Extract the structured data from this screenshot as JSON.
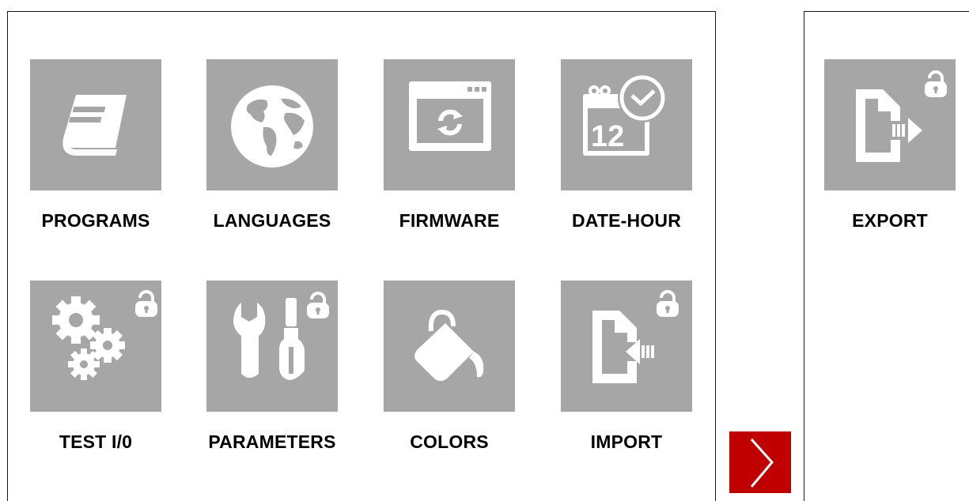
{
  "menu": {
    "items": [
      {
        "label": "PROGRAMS",
        "icon": "book-icon",
        "locked": false
      },
      {
        "label": "LANGUAGES",
        "icon": "globe-icon",
        "locked": false
      },
      {
        "label": "FIRMWARE",
        "icon": "firmware-refresh-icon",
        "locked": false
      },
      {
        "label": "DATE-HOUR",
        "icon": "calendar-clock-icon",
        "locked": false
      },
      {
        "label": "TEST I/0",
        "icon": "gears-icon",
        "locked": true
      },
      {
        "label": "PARAMETERS",
        "icon": "tools-icon",
        "locked": true
      },
      {
        "label": "COLORS",
        "icon": "paint-bucket-icon",
        "locked": false
      },
      {
        "label": "IMPORT",
        "icon": "file-import-icon",
        "locked": true
      }
    ]
  },
  "side_menu": {
    "items": [
      {
        "label": "EXPORT",
        "icon": "file-export-icon",
        "locked": true
      }
    ]
  },
  "navigation": {
    "next_icon": "chevron-right-icon"
  },
  "colors": {
    "tile": "#a6a6a6",
    "icon": "#ffffff",
    "next_button": "#c00000"
  }
}
